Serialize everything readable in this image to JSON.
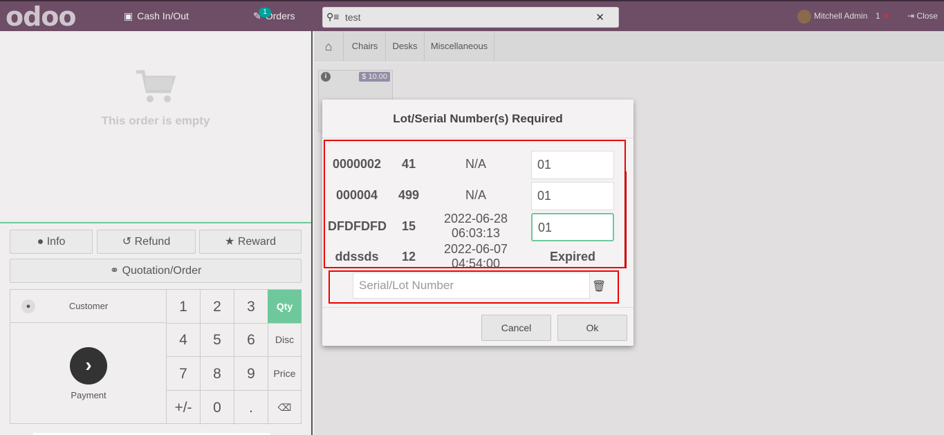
{
  "header": {
    "logo": "odoo",
    "cash_label": "Cash In/Out",
    "orders_label": "Orders",
    "orders_count": "1",
    "search_value": "test",
    "user_name": "Mitchell Admin",
    "sync_count": "1",
    "close_label": "Close"
  },
  "order": {
    "empty_text": "This order is empty"
  },
  "controls": {
    "info_label": "Info",
    "refund_label": "Refund",
    "reward_label": "Reward",
    "quotation_label": "Quotation/Order"
  },
  "numpad": {
    "customer_label": "Customer",
    "payment_label": "Payment",
    "keys": [
      "1",
      "2",
      "3",
      "Qty",
      "4",
      "5",
      "6",
      "Disc",
      "7",
      "8",
      "9",
      "Price",
      "+/-",
      "0",
      "."
    ]
  },
  "categories": [
    "Chairs",
    "Desks",
    "Miscellaneous"
  ],
  "product": {
    "price": "$ 10.00"
  },
  "modal": {
    "title": "Lot/Serial Number(s) Required",
    "lots": [
      {
        "name": "0000002",
        "qty": "41",
        "date": "N/A",
        "value": "01"
      },
      {
        "name": "000004",
        "qty": "499",
        "date": "N/A",
        "value": "01"
      },
      {
        "name": "DFDFDFD",
        "qty": "15",
        "date_line1": "2022-06-28",
        "date_line2": "06:03:13",
        "value": "01"
      },
      {
        "name": "ddssds",
        "qty": "12",
        "date_line1": "2022-06-07",
        "date_line2": "04:54:00",
        "status": "Expired"
      }
    ],
    "new_lot_placeholder": "Serial/Lot Number",
    "cancel_label": "Cancel",
    "ok_label": "Ok"
  },
  "colors": {
    "header_bg": "#6e4d66",
    "accent": "#6ec89b",
    "highlight_box": "#e00000"
  }
}
